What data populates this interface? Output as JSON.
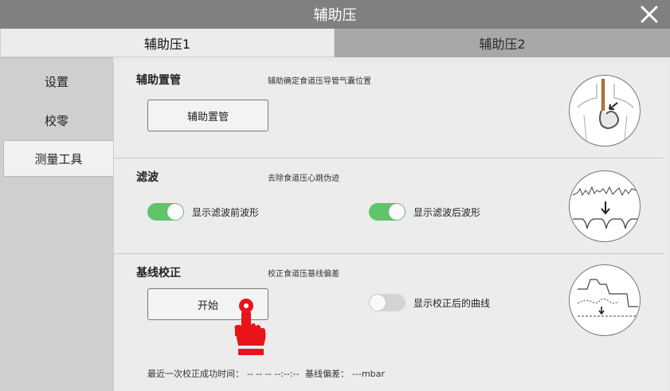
{
  "window": {
    "title": "辅助压"
  },
  "tabs": [
    {
      "label": "辅助压1"
    },
    {
      "label": "辅助压2"
    }
  ],
  "sidebar": {
    "items": [
      {
        "label": "设置"
      },
      {
        "label": "校零"
      },
      {
        "label": "测量工具"
      }
    ]
  },
  "sections": {
    "placement": {
      "title": "辅助置管",
      "description": "辅助确定食道压导管气囊位置",
      "button_label": "辅助置管",
      "illustration": "stomach-catheter-illustration"
    },
    "filter": {
      "title": "滤波",
      "description": "去除食道压心跳伪迹",
      "toggle_before_label": "显示滤波前波形",
      "toggle_before_on": true,
      "toggle_after_label": "显示滤波后波形",
      "toggle_after_on": true,
      "illustration": "waveform-filter-illustration"
    },
    "baseline": {
      "title": "基线校正",
      "description": "校正食道压基线偏差",
      "button_label": "开始",
      "toggle_label": "显示校正后的曲线",
      "toggle_on": false,
      "illustration": "baseline-shift-illustration"
    }
  },
  "footer": {
    "last_label": "最近一次校正成功时间：",
    "last_value": "-- -- --  --:--:--",
    "offset_label": "基线偏差：",
    "offset_value": "---mbar"
  },
  "colors": {
    "titlebar": "#808080",
    "toggle_on": "#5fc46a",
    "toggle_off": "#d4d4d4",
    "hand_pointer": "#e8141a"
  },
  "icons": {
    "close": "close-icon",
    "pointer": "hand-pointer-icon"
  }
}
